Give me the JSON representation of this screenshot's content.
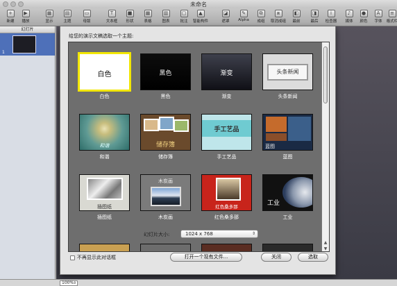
{
  "window": {
    "title": "未命名"
  },
  "toolbar": [
    {
      "label": "新建",
      "icon": "plus-icon",
      "glyph": "+"
    },
    {
      "label": "播放",
      "icon": "play-icon",
      "glyph": "▶"
    },
    {
      "label": "显示",
      "icon": "view-icon",
      "glyph": "▦"
    },
    {
      "label": "主题",
      "icon": "themes-icon",
      "glyph": "▤"
    },
    {
      "label": "母版",
      "icon": "masters-icon",
      "glyph": "▭"
    },
    {
      "label": "文本框",
      "icon": "textbox-icon",
      "glyph": "T"
    },
    {
      "label": "形状",
      "icon": "shapes-icon",
      "glyph": "■"
    },
    {
      "label": "表格",
      "icon": "table-icon",
      "glyph": "▦"
    },
    {
      "label": "图表",
      "icon": "chart-icon",
      "glyph": "▥"
    },
    {
      "label": "批注",
      "icon": "comment-icon",
      "glyph": "▢"
    },
    {
      "label": "智能构件",
      "icon": "smart-builds-icon",
      "glyph": "▲"
    },
    {
      "label": "遮罩",
      "icon": "mask-icon",
      "glyph": "◪"
    },
    {
      "label": "Alpha",
      "icon": "alpha-icon",
      "glyph": "✎"
    },
    {
      "label": "成组",
      "icon": "group-icon",
      "glyph": "⧉"
    },
    {
      "label": "取消成组",
      "icon": "ungroup-icon",
      "glyph": "⧈"
    },
    {
      "label": "最前",
      "icon": "front-icon",
      "glyph": "◧"
    },
    {
      "label": "最后",
      "icon": "back-icon",
      "glyph": "◨"
    },
    {
      "label": "检查器",
      "icon": "inspector-icon",
      "glyph": "i"
    },
    {
      "label": "媒体",
      "icon": "media-icon",
      "glyph": "♪"
    },
    {
      "label": "颜色",
      "icon": "colors-icon",
      "glyph": "●"
    },
    {
      "label": "字体",
      "icon": "fonts-icon",
      "glyph": "A"
    },
    {
      "label": "格式栏",
      "icon": "format-bar-icon",
      "glyph": "≡"
    }
  ],
  "sidebar": {
    "header": "幻灯片",
    "slide_number": "1"
  },
  "dialog": {
    "prompt": "给您的演示文稿选取一个主题:",
    "themes": [
      {
        "name": "白色",
        "caption": "白色",
        "selected": true
      },
      {
        "name": "黑色",
        "caption": "黑色",
        "selected": false
      },
      {
        "name": "渐变",
        "caption": "渐变",
        "selected": false
      },
      {
        "name": "头条新闻",
        "caption": "头条新闻",
        "selected": false
      },
      {
        "name": "和谐",
        "caption": "和谐",
        "selected": false
      },
      {
        "name": "储存簿",
        "caption": "储存簿",
        "selected": false
      },
      {
        "name": "手工艺品",
        "caption": "手工艺品",
        "selected": false
      },
      {
        "name": "蓝图",
        "caption": "蓝图",
        "selected": false
      },
      {
        "name": "插图纸",
        "caption": "插图纸",
        "selected": false
      },
      {
        "name": "木炭画",
        "caption": "木炭画",
        "selected": false
      },
      {
        "name": "红色桑多那",
        "caption": "红色桑多那",
        "selected": false
      },
      {
        "name": "工业",
        "caption": "工业",
        "selected": false
      }
    ],
    "size_label": "幻灯片大小:",
    "size_value": "1024 x 768",
    "dont_show_label": "不再显示此对话框",
    "open_existing_button": "打开一个现有文件...",
    "close_button": "关闭",
    "choose_button": "选取"
  },
  "statusbar": {
    "zoom": "100%"
  }
}
